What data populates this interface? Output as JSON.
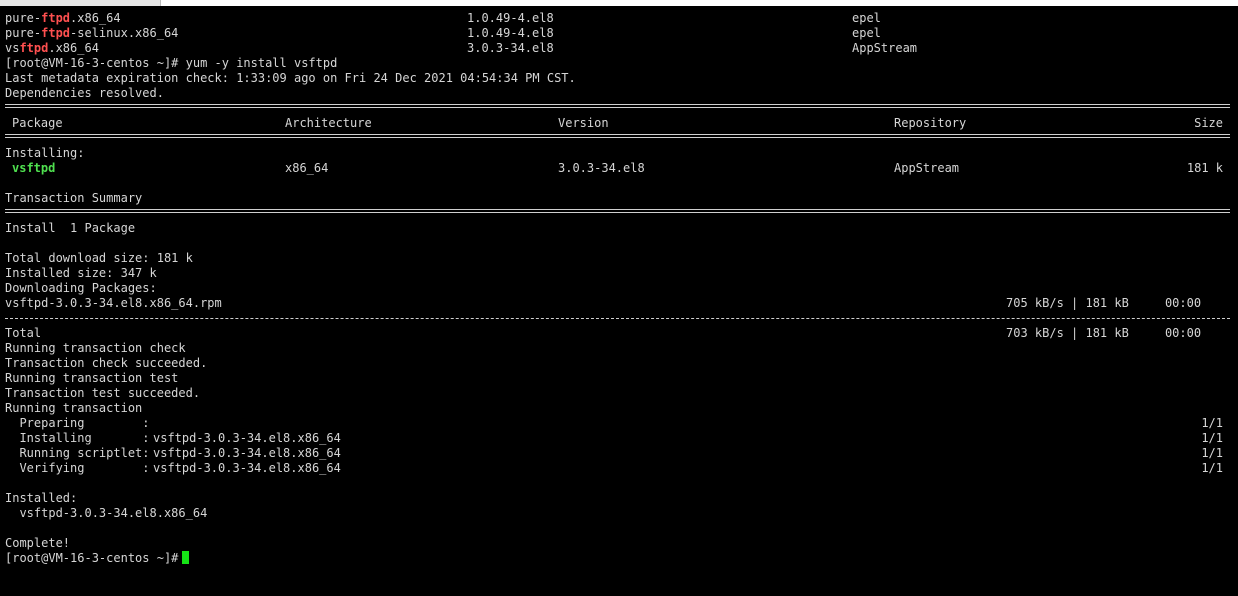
{
  "prev_results": [
    {
      "pre": "pure-",
      "hl": "ftpd",
      "post": ".x86_64",
      "version": "1.0.49-4.el8",
      "repo": "epel"
    },
    {
      "pre": "pure-",
      "hl": "ftpd",
      "post": "-selinux.x86_64",
      "version": "1.0.49-4.el8",
      "repo": "epel"
    },
    {
      "pre": "vs",
      "hl": "ftpd",
      "post": ".x86_64",
      "version": "3.0.3-34.el8",
      "repo": "AppStream"
    }
  ],
  "command_prompt": "[root@VM-16-3-centos ~]# yum -y install vsftpd",
  "metadata_check": "Last metadata expiration check: 1:33:09 ago on Fri 24 Dec 2021 04:54:34 PM CST.",
  "deps_resolved": "Dependencies resolved.",
  "table_headers": {
    "package": "Package",
    "architecture": "Architecture",
    "version": "Version",
    "repository": "Repository",
    "size": "Size"
  },
  "installing_label": "Installing:",
  "package_row": {
    "name": "vsftpd",
    "arch": "x86_64",
    "version": "3.0.3-34.el8",
    "repo": "AppStream",
    "size": "181 k"
  },
  "transaction_summary": "Transaction Summary",
  "install_count": "Install  1 Package",
  "total_download": "Total download size: 181 k",
  "installed_size": "Installed size: 347 k",
  "downloading": "Downloading Packages:",
  "rpm_file": {
    "name": "vsftpd-3.0.3-34.el8.x86_64.rpm",
    "stats": "705 kB/s | 181 kB     00:00"
  },
  "total_line": {
    "label": "Total",
    "stats": "703 kB/s | 181 kB     00:00"
  },
  "transaction_lines": [
    "Running transaction check",
    "Transaction check succeeded.",
    "Running transaction test",
    "Transaction test succeeded.",
    "Running transaction"
  ],
  "steps": [
    {
      "label": "  Preparing        :",
      "detail": "",
      "progress": "1/1"
    },
    {
      "label": "  Installing       :",
      "detail": "vsftpd-3.0.3-34.el8.x86_64",
      "progress": "1/1"
    },
    {
      "label": "  Running scriptlet:",
      "detail": "vsftpd-3.0.3-34.el8.x86_64",
      "progress": "1/1"
    },
    {
      "label": "  Verifying        :",
      "detail": "vsftpd-3.0.3-34.el8.x86_64",
      "progress": "1/1"
    }
  ],
  "installed_label": "Installed:",
  "installed_pkg": "  vsftpd-3.0.3-34.el8.x86_64",
  "complete": "Complete!",
  "final_prompt": "[root@VM-16-3-centos ~]#",
  "colors": {
    "background": "#000000",
    "text": "#d6d6d6",
    "highlight_red": "#ff5050",
    "highlight_green": "#4fe04f",
    "cursor": "#16e316"
  }
}
